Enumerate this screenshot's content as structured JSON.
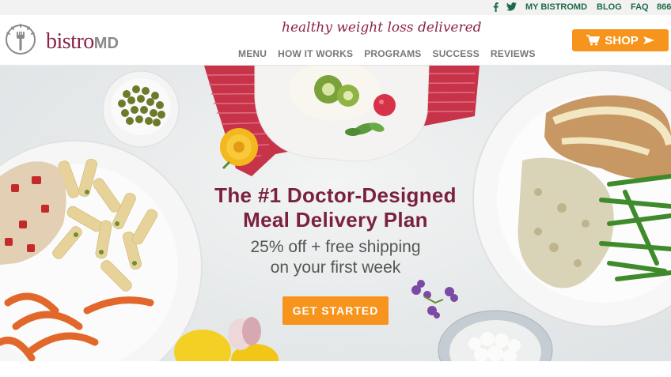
{
  "topbar": {
    "facebook_icon": "facebook-icon",
    "twitter_icon": "twitter-icon",
    "my_bistromd": "MY BISTROMD",
    "blog": "BLOG",
    "faq": "FAQ",
    "phone": "866"
  },
  "header": {
    "logo_text_main": "bistro",
    "logo_text_md": "MD",
    "tagline": "healthy weight loss delivered",
    "nav": [
      {
        "label": "MENU"
      },
      {
        "label": "HOW IT WORKS"
      },
      {
        "label": "PROGRAMS"
      },
      {
        "label": "SUCCESS"
      },
      {
        "label": "REVIEWS"
      }
    ],
    "shop_label": "SHOP"
  },
  "hero": {
    "headline_line1": "The #1 Doctor-Designed",
    "headline_line2": "Meal Delivery Plan",
    "sub_line1": "25% off + free shipping",
    "sub_line2": "on your first week",
    "cta_label": "GET STARTED"
  },
  "colors": {
    "brand_maroon": "#8b2346",
    "accent_orange": "#f7941d",
    "util_green": "#1d6b45"
  }
}
